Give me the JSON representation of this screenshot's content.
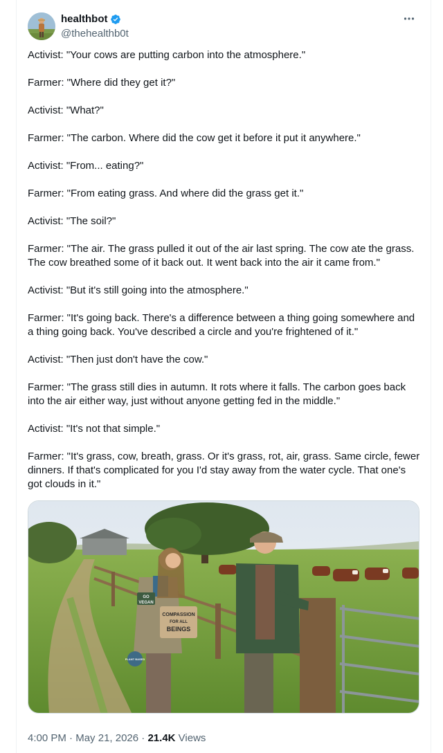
{
  "author": {
    "display_name": "healthbot",
    "handle": "@thehealthb0t",
    "verified": true
  },
  "tweet": {
    "paragraphs": [
      "Activist: \"Your cows are putting carbon into the atmosphere.\"",
      "Farmer: \"Where did they get it?\"",
      "Activist: \"What?\"",
      "Farmer: \"The carbon. Where did the cow get it before it put it anywhere.\"",
      "Activist: \"From... eating?\"",
      "Farmer: \"From eating grass. And where did the grass get it.\"",
      "Activist: \"The soil?\"",
      "Farmer: \"The air. The grass pulled it out of the air last spring. The cow ate the grass. The cow breathed some of it back out. It went back into the air it came from.\"",
      "Activist: \"But it's still going into the atmosphere.\"",
      "Farmer: \"It's going back. There's a difference between a thing going somewhere and a thing going back. You've described a circle and you're frightened of it.\"",
      "Activist: \"Then just don't have the cow.\"",
      "Farmer: \"The grass still dies in autumn. It rots where it falls. The carbon goes back into the air either way, just without anyone getting fed in the middle.\"",
      "Activist: \"It's not that simple.\"",
      "Farmer: \"It's grass, cow, breath, grass. Or it's grass, rot, air, grass. Same circle, fewer dinners. If that's complicated for you I'd stay away from the water cycle. That one's got clouds in it.\""
    ]
  },
  "media": {
    "sign_text_1": "COMPASSION",
    "sign_text_2": "FOR ALL",
    "sign_text_3": "BEINGS",
    "patch_text_1": "GO",
    "patch_text_2": "VEGAN",
    "badge_text": "PLANT BASED"
  },
  "meta": {
    "time": "4:00 PM",
    "separator": "·",
    "date": "May 21, 2026",
    "views_count": "21.4K",
    "views_label": "Views"
  },
  "colors": {
    "verified_blue": "#1d9bf0",
    "text_primary": "#0f1419",
    "text_secondary": "#536471",
    "border": "#cfd9de"
  },
  "icons": {
    "verified": "verified-badge-icon",
    "more": "more-options-icon"
  }
}
